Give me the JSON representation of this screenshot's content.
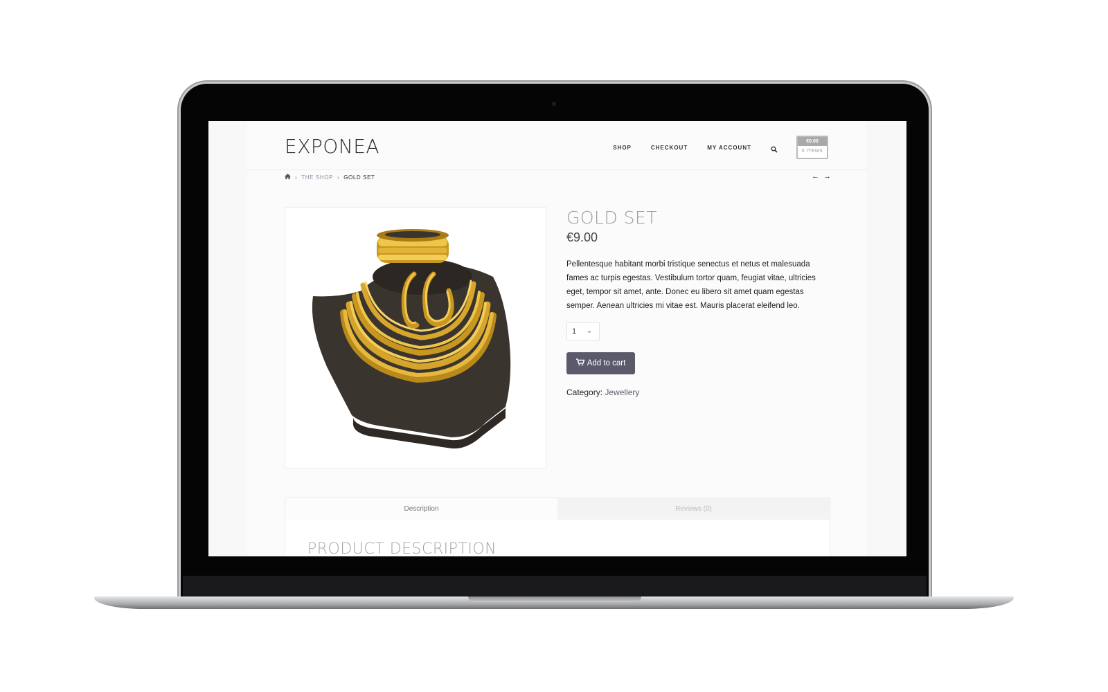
{
  "site": {
    "logo": "EXPONEA"
  },
  "nav": {
    "items": [
      {
        "label": "SHOP"
      },
      {
        "label": "CHECKOUT"
      },
      {
        "label": "MY ACCOUNT"
      }
    ],
    "search_icon": "search-icon",
    "cart": {
      "total": "€0.00",
      "count": "0 ITEMS"
    }
  },
  "breadcrumb": {
    "home_icon": "home-icon",
    "items": [
      {
        "label": "THE SHOP"
      },
      {
        "label": "GOLD SET"
      }
    ]
  },
  "product": {
    "title": "GOLD SET",
    "price": "€9.00",
    "description": "Pellentesque habitant morbi tristique senectus et netus et malesuada fames ac turpis egestas. Vestibulum tortor quam, feugiat vitae, ultricies eget, tempor sit amet, ante. Donec eu libero sit amet quam egestas semper. Aenean ultricies mi vitae est. Mauris placerat eleifend leo.",
    "quantity": "1",
    "add_to_cart_label": "Add to cart",
    "category_label": "Category:",
    "category_value": "Jewellery",
    "image_icon": "gold-jewellery-set-image"
  },
  "tabs": [
    {
      "label": "Description"
    },
    {
      "label": "Reviews (0)"
    }
  ],
  "tab_panel": {
    "heading": "PRODUCT DESCRIPTION"
  },
  "colors": {
    "accent": "#5b5a6b",
    "gold": "#e0b53a",
    "bust": "#3a342f"
  }
}
